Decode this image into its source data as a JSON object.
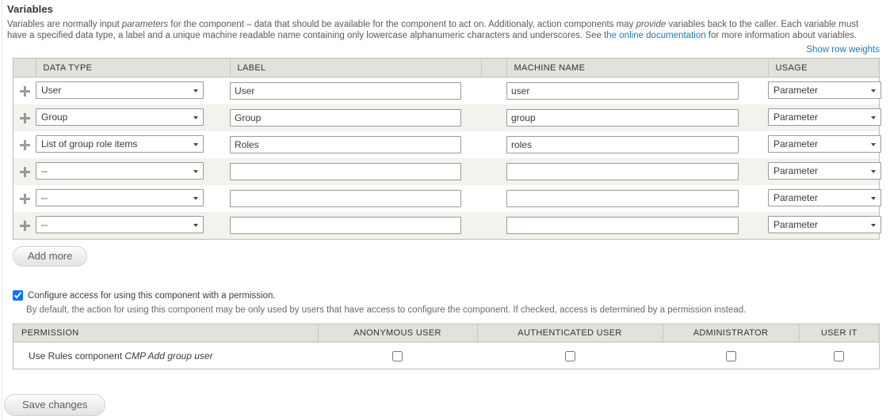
{
  "section": {
    "title": "Variables",
    "description_part1": "Variables are normally input ",
    "description_em1": "parameters",
    "description_part2": " for the component – data that should be available for the component to act on. Additionaly, action components may ",
    "description_em2": "provide",
    "description_part3": " variables back to the caller. Each variable must have a specified data type, a label and a unique machine readable name containing only lowercase alphanumeric characters and underscores. See ",
    "link_text": "the online documentation",
    "description_part4": " for more information about variables.",
    "show_row_weights": "Show row weights"
  },
  "variables_table": {
    "headers": {
      "data_type": "DATA TYPE",
      "label": "LABEL",
      "gap": "",
      "machine_name": "MACHINE NAME",
      "usage": "USAGE"
    },
    "rows": [
      {
        "data_type": "User",
        "label": "User",
        "machine_name": "user",
        "usage": "Parameter"
      },
      {
        "data_type": "Group",
        "label": "Group",
        "machine_name": "group",
        "usage": "Parameter"
      },
      {
        "data_type": "List of group role items",
        "label": "Roles",
        "machine_name": "roles",
        "usage": "Parameter"
      },
      {
        "data_type": "--",
        "label": "",
        "machine_name": "",
        "usage": "Parameter"
      },
      {
        "data_type": "--",
        "label": "",
        "machine_name": "",
        "usage": "Parameter"
      },
      {
        "data_type": "--",
        "label": "",
        "machine_name": "",
        "usage": "Parameter"
      }
    ]
  },
  "add_more": {
    "label": "Add more"
  },
  "permission_config": {
    "checkbox_label": "Configure access for using this component with a permission.",
    "checkbox_checked": true,
    "hint": "By default, the action for using this component may be only used by users that have access to configure the component. If checked, access is determined by a permission instead."
  },
  "permission_table": {
    "headers": [
      "PERMISSION",
      "ANONYMOUS USER",
      "AUTHENTICATED USER",
      "ADMINISTRATOR",
      "USER IT"
    ],
    "rows": [
      {
        "name_prefix": "Use Rules component ",
        "name_em": "CMP Add group user",
        "checks": [
          false,
          false,
          false,
          false
        ]
      }
    ]
  },
  "save": {
    "label": "Save changes"
  },
  "colors": {
    "link": "#1f7bb6",
    "header_bg": "#e1e2dc",
    "row_alt_bg": "#f2f3ed",
    "border": "#bebfb9"
  }
}
